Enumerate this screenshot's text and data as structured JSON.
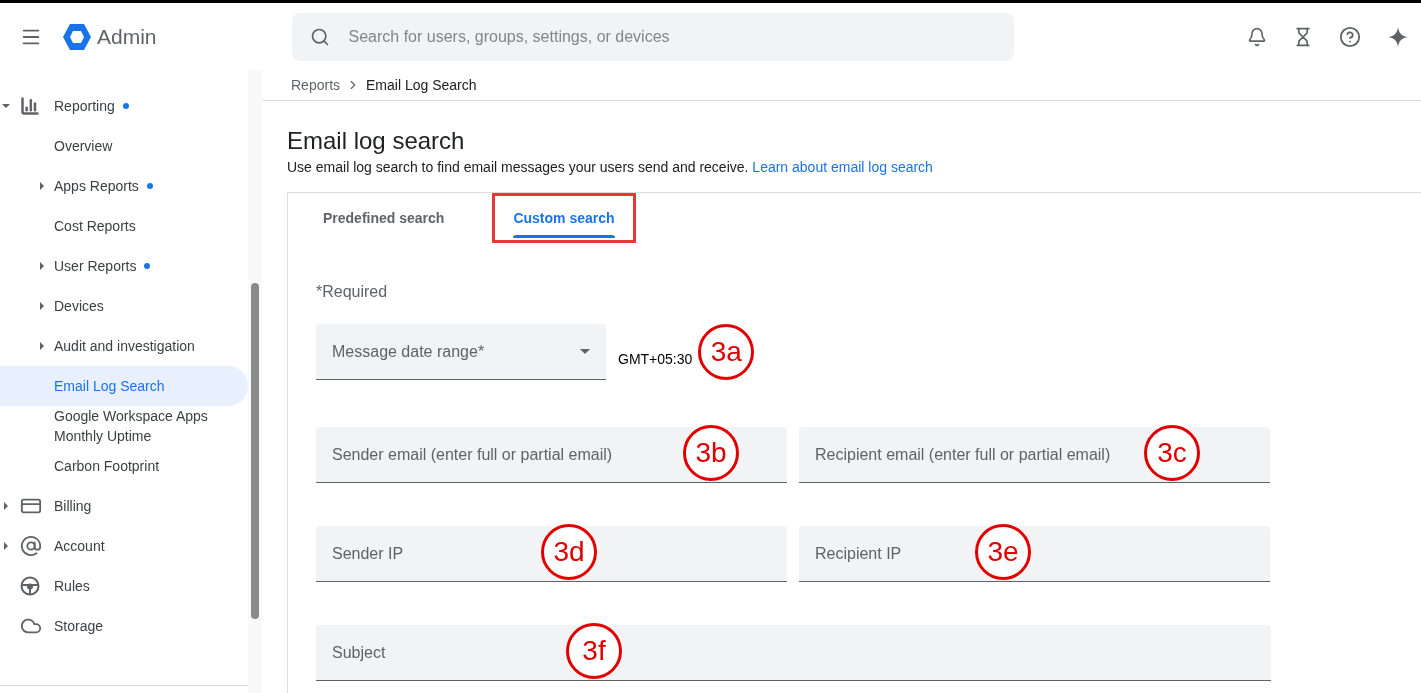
{
  "header": {
    "app_name": "Admin",
    "search": {
      "placeholder": "Search for users, groups, settings, or devices"
    }
  },
  "sidebar": {
    "items": [
      {
        "label": "Reporting",
        "notified": true,
        "expanded": true,
        "selected": false,
        "children": [
          {
            "label": "Overview",
            "notified": false,
            "selected": false
          },
          {
            "label": "Apps Reports",
            "notified": true,
            "expanded": false,
            "selected": false
          },
          {
            "label": "Cost Reports",
            "notified": false,
            "selected": false
          },
          {
            "label": "User Reports",
            "notified": true,
            "expanded": false,
            "selected": false
          },
          {
            "label": "Devices",
            "notified": false,
            "expanded": false,
            "selected": false
          },
          {
            "label": "Audit and investigation",
            "notified": false,
            "expanded": false,
            "selected": false
          },
          {
            "label": "Email Log Search",
            "notified": false,
            "selected": true
          },
          {
            "label": "Google Workspace Apps Monthly Uptime",
            "notified": false,
            "selected": false
          },
          {
            "label": "Carbon Footprint",
            "notified": false,
            "selected": false
          }
        ]
      },
      {
        "label": "Billing",
        "notified": false,
        "expanded": false,
        "selected": false
      },
      {
        "label": "Account",
        "notified": false,
        "expanded": false,
        "selected": false
      },
      {
        "label": "Rules",
        "notified": false,
        "selected": false
      },
      {
        "label": "Storage",
        "notified": false,
        "selected": false
      }
    ]
  },
  "breadcrumb": [
    "Reports",
    "Email Log Search"
  ],
  "page": {
    "title": "Email log search",
    "description": "Use email log search to find email messages your users send and receive.",
    "link": "Learn about email log search"
  },
  "tabs": [
    {
      "label": "Predefined search",
      "selected": false,
      "highlighted": false
    },
    {
      "label": "Custom search",
      "selected": true,
      "highlighted": true
    }
  ],
  "required_note": "*Required",
  "date_range": {
    "placeholder": "Message date range*",
    "timezone": "GMT+05:30",
    "callout": "3a"
  },
  "fields": [
    {
      "placeholder": "Sender email (enter full or partial email)",
      "callout": "3b"
    },
    {
      "placeholder": "Recipient email (enter full or partial email)",
      "callout": "3c"
    },
    {
      "placeholder": "Sender IP",
      "callout": "3d"
    },
    {
      "placeholder": "Recipient IP",
      "callout": "3e"
    },
    {
      "placeholder": "Subject",
      "callout": "3f",
      "wide": true
    }
  ]
}
